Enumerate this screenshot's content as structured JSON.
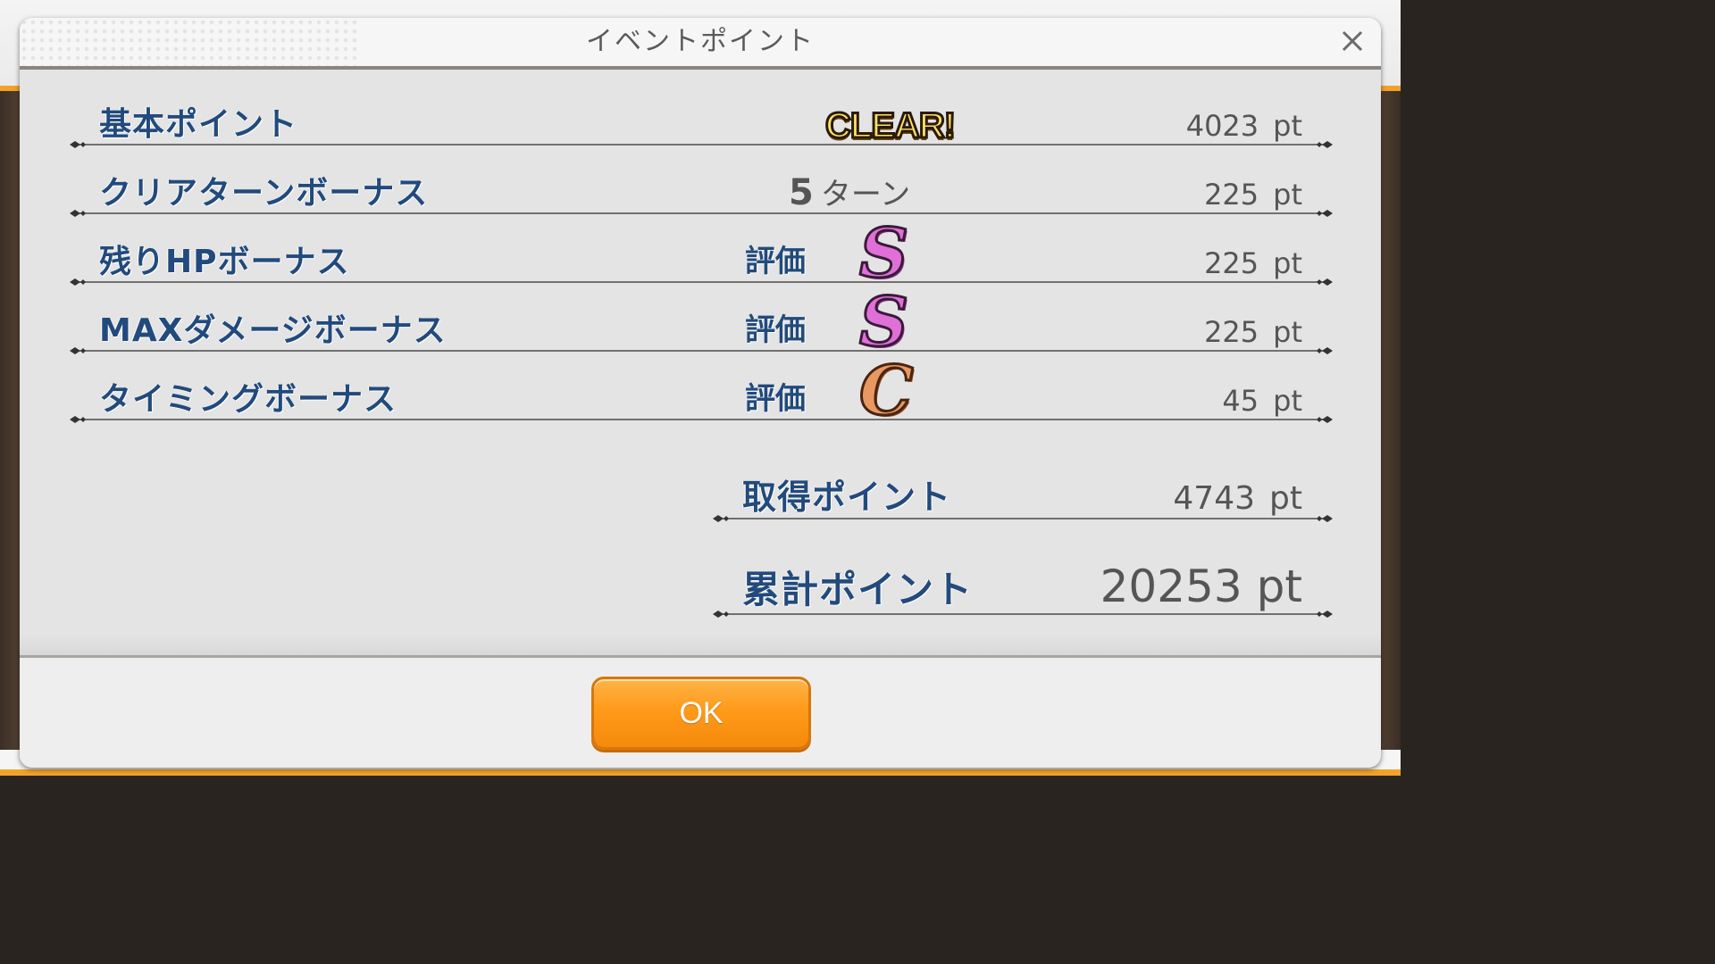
{
  "dialog": {
    "title": "イベントポイント",
    "close_icon": "close-icon"
  },
  "rows": [
    {
      "label": "基本ポイント",
      "badge": "CLEAR!",
      "value": "4023",
      "unit": "pt"
    },
    {
      "label": "クリアターンボーナス",
      "turns_number": "5",
      "turns_unit": "ターン",
      "value": "225",
      "unit": "pt"
    },
    {
      "label": "残りHPボーナス",
      "eval_label": "評価",
      "rank": "S",
      "value": "225",
      "unit": "pt"
    },
    {
      "label": "MAXダメージボーナス",
      "eval_label": "評価",
      "rank": "S",
      "value": "225",
      "unit": "pt"
    },
    {
      "label": "タイミングボーナス",
      "eval_label": "評価",
      "rank": "C",
      "value": "45",
      "unit": "pt"
    }
  ],
  "earned": {
    "label": "取得ポイント",
    "value": "4743",
    "unit": "pt"
  },
  "cumulative": {
    "label": "累計ポイント",
    "value": "20253",
    "unit": "pt"
  },
  "footer": {
    "ok_label": "OK"
  },
  "colors": {
    "label_blue": "#224a7c",
    "ok_orange": "#ff9a1a",
    "rank_s": "#e070d8",
    "rank_c": "#e89860"
  }
}
